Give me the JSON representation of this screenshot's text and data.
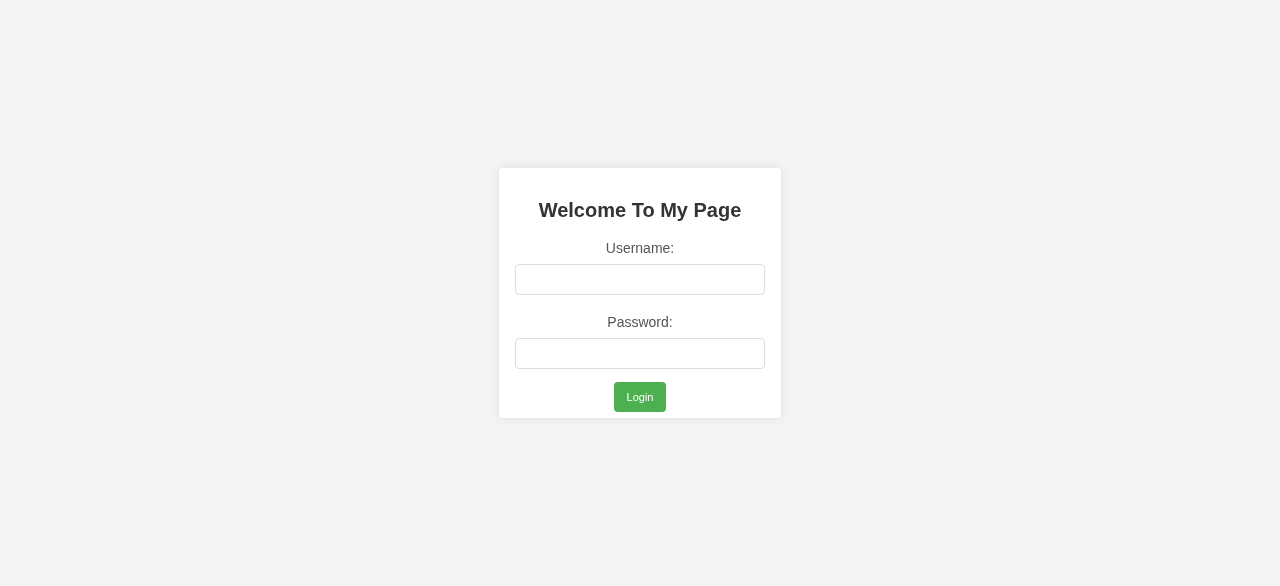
{
  "title": "Welcome To My Page",
  "fields": [
    {
      "label": "Username:"
    },
    {
      "label": "Password:"
    }
  ],
  "button": "Login"
}
